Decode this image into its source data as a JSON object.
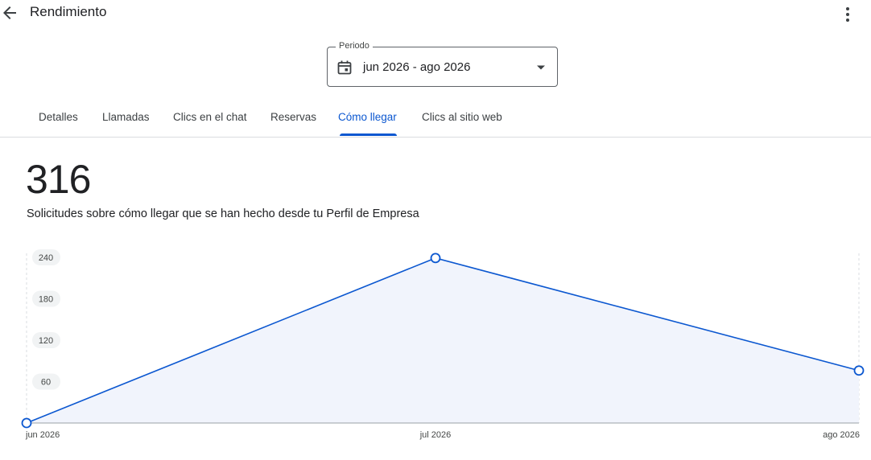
{
  "header": {
    "title": "Rendimiento",
    "back_icon": "arrow-left-icon",
    "menu_icon": "more-vert-icon"
  },
  "period": {
    "label": "Periodo",
    "value": "jun 2026 - ago 2026",
    "calendar_icon": "calendar-icon",
    "dropdown_icon": "caret-down-icon"
  },
  "tabs": [
    {
      "label": "Detalles"
    },
    {
      "label": "Llamadas"
    },
    {
      "label": "Clics en el chat"
    },
    {
      "label": "Reservas"
    },
    {
      "label": "Cómo llegar"
    },
    {
      "label": "Clics al sitio web"
    }
  ],
  "active_tab": "Cómo llegar",
  "metric": {
    "value": "316",
    "description": "Solicitudes sobre cómo llegar que se han hecho desde tu Perfil de Empresa"
  },
  "colors": {
    "accent": "#0b57d0",
    "area_fill": "#f1f4fc",
    "text": "#202124"
  },
  "chart_data": {
    "type": "area",
    "categories": [
      "jun 2026",
      "jul 2026",
      "ago 2026"
    ],
    "series": [
      {
        "values": [
          0,
          239,
          76
        ]
      }
    ],
    "y_ticks": [
      "60",
      "120",
      "180",
      "240"
    ],
    "ylim": [
      0,
      240
    ],
    "grid": "vertical dashed"
  }
}
